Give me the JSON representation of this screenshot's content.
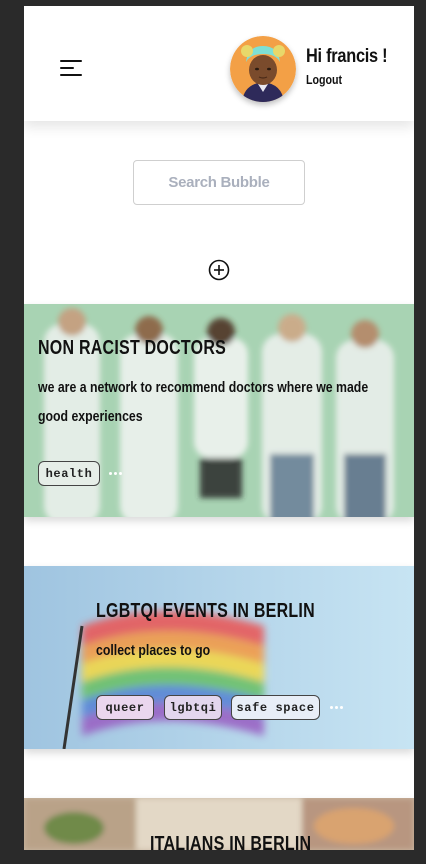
{
  "user": {
    "greeting": "Hi francis !",
    "logout_label": "Logout"
  },
  "search": {
    "placeholder": "Search Bubble"
  },
  "bubbles": [
    {
      "title": "NON RACIST DOCTORS",
      "description": "we are a network to recommend doctors where we made good experiences",
      "tags": [
        "health"
      ]
    },
    {
      "title": "LGBTQI EVENTS IN BERLIN",
      "description": "collect places to go",
      "tags": [
        "queer",
        "lgbtqi",
        "safe space"
      ]
    },
    {
      "title": "ITALIANS IN BERLIN"
    }
  ],
  "icons": {
    "menu": "hamburger-menu-icon",
    "add": "plus-circle-icon",
    "more": "ellipsis-icon"
  },
  "colors": {
    "card1_bg": "#a8d3b3",
    "card2_bg": "#a9cfe8",
    "card3_bg": "#c9b9a4",
    "avatar_bg": "#f3a046"
  }
}
